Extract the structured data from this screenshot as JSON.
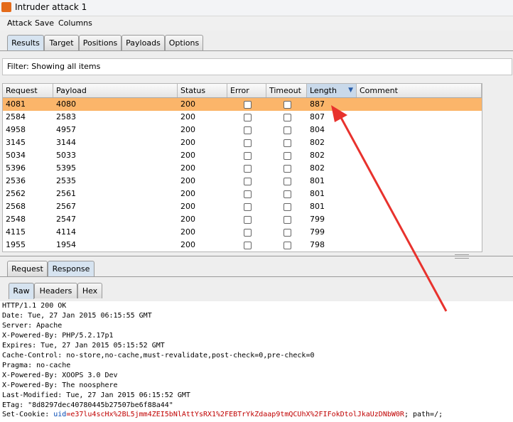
{
  "window": {
    "title": "Intruder attack 1"
  },
  "menu": [
    "Attack",
    "Save",
    "Columns"
  ],
  "main_tabs": [
    "Results",
    "Target",
    "Positions",
    "Payloads",
    "Options"
  ],
  "filter": {
    "text": "Filter: Showing all items"
  },
  "table": {
    "columns": [
      "Request",
      "Payload",
      "Status",
      "Error",
      "Timeout",
      "Length",
      "Comment"
    ],
    "sorted_column": "Length",
    "rows": [
      {
        "request": "4081",
        "payload": "4080",
        "status": "200",
        "length": "887",
        "selected": true
      },
      {
        "request": "2584",
        "payload": "2583",
        "status": "200",
        "length": "807"
      },
      {
        "request": "4958",
        "payload": "4957",
        "status": "200",
        "length": "804"
      },
      {
        "request": "3145",
        "payload": "3144",
        "status": "200",
        "length": "802"
      },
      {
        "request": "5034",
        "payload": "5033",
        "status": "200",
        "length": "802"
      },
      {
        "request": "5396",
        "payload": "5395",
        "status": "200",
        "length": "802"
      },
      {
        "request": "2536",
        "payload": "2535",
        "status": "200",
        "length": "801"
      },
      {
        "request": "2562",
        "payload": "2561",
        "status": "200",
        "length": "801"
      },
      {
        "request": "2568",
        "payload": "2567",
        "status": "200",
        "length": "801"
      },
      {
        "request": "2548",
        "payload": "2547",
        "status": "200",
        "length": "799"
      },
      {
        "request": "4115",
        "payload": "4114",
        "status": "200",
        "length": "799"
      },
      {
        "request": "1955",
        "payload": "1954",
        "status": "200",
        "length": "798"
      }
    ]
  },
  "detail_tabs": [
    "Request",
    "Response"
  ],
  "view_tabs": [
    "Raw",
    "Headers",
    "Hex"
  ],
  "response": {
    "lines": [
      "HTTP/1.1 200 OK",
      "Date: Tue, 27 Jan 2015 06:15:55 GMT",
      "Server: Apache",
      "X-Powered-By: PHP/5.2.17p1",
      "Expires: Tue, 27 Jan 2015 05:15:52 GMT",
      "Cache-Control: no-store,no-cache,must-revalidate,post-check=0,pre-check=0",
      "Pragma: no-cache",
      "X-Powered-By: XOOPS 3.0 Dev",
      "X-Powered-By: The noosphere",
      "Last-Modified: Tue, 27 Jan 2015 06:15:52 GMT",
      "ETag: \"8d8297dec40780445b27507be6f88a44\""
    ],
    "cookie_label": "Set-Cookie: ",
    "cookie_name": "uid",
    "cookie_value": "=e37lu4scHx%2BL5jmm4ZEI5bNlAttYsRX1%2FEBTrYkZdaap9tmQCUhX%2FIFokDtolJkaUzDNbW0R",
    "cookie_tail": "; path=/;"
  },
  "colors": {
    "selected_row": "#fbb56a",
    "arrow": "#e8322d",
    "sorted_header": "#c9d9ea"
  }
}
